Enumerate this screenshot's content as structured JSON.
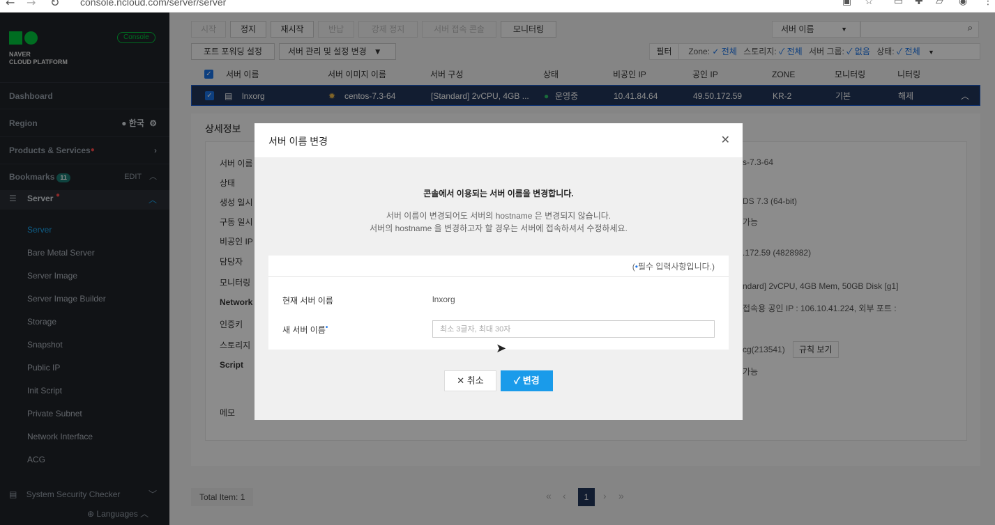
{
  "browser": {
    "url": "console.ncloud.com/server/server",
    "back_icon": "back-arrow-icon",
    "forward_icon": "forward-arrow-icon",
    "reload_icon": "reload-icon"
  },
  "sidebar": {
    "logo_line1": "NAVER",
    "logo_line2": "CLOUD PLATFORM",
    "console_badge": "Console",
    "dashboard": "Dashboard",
    "region_label": "Region",
    "region_value": "한국",
    "products": "Products & Services",
    "bookmarks": "Bookmarks",
    "bookmarks_count": "11",
    "bookmarks_edit": "EDIT",
    "server_group": "Server",
    "items": [
      {
        "label": "Server",
        "active": true
      },
      {
        "label": "Bare Metal Server",
        "active": false
      },
      {
        "label": "Server Image",
        "active": false
      },
      {
        "label": "Server Image Builder",
        "active": false
      },
      {
        "label": "Storage",
        "active": false
      },
      {
        "label": "Snapshot",
        "active": false
      },
      {
        "label": "Public IP",
        "active": false
      },
      {
        "label": "Init Script",
        "active": false
      },
      {
        "label": "Private Subnet",
        "active": false
      },
      {
        "label": "Network Interface",
        "active": false
      },
      {
        "label": "ACG",
        "active": false
      }
    ],
    "security_checker": "System Security Checker",
    "languages": "Languages"
  },
  "toolbar": {
    "start": "시작",
    "stop": "정지",
    "restart": "재시작",
    "return": "반납",
    "force_stop": "강제 정지",
    "console_access": "서버 접속 콘솔",
    "monitoring": "모니터링",
    "port_forward": "포트 포워딩 설정",
    "manage": "서버 관리 및 설정 변경",
    "search_select": "서버 이름",
    "filter": "필터",
    "filter_zone": "Zone:",
    "filter_all": "전체",
    "filter_storage": "스토리지:",
    "filter_group": "서버 그룹:",
    "filter_none": "없음",
    "filter_status": "상태:"
  },
  "table": {
    "headers": [
      "서버 이름",
      "서버 이미지 이름",
      "서버 구성",
      "상태",
      "비공인 IP",
      "공인 IP",
      "ZONE",
      "모니터링",
      "니터링"
    ],
    "row": {
      "name": "lnxorg",
      "image": "centos-7.3-64",
      "spec": "[Standard] 2vCPU, 4GB ...",
      "status": "운영중",
      "private_ip": "10.41.84.64",
      "public_ip": "49.50.172.59",
      "zone": "KR-2",
      "monitoring": "기본",
      "monitoring2": "해제"
    }
  },
  "detail": {
    "title": "상세정보",
    "labels": [
      "서버 이름",
      "상태",
      "생성 일시",
      "구동 일시",
      "비공인 IP",
      "담당자",
      "모니터링",
      "Network",
      "인증키",
      "스토리지",
      "Script",
      "메모"
    ],
    "values": [
      "s-7.3-64",
      "DS 7.3 (64-bit)",
      "가능",
      ".172.59 (4828982)",
      "ndard] 2vCPU, 4GB Mem, 50GB Disk [g1]",
      "접속용 공인 IP : 106.10.41.224, 외부 포트 :",
      "cg(213541)",
      "가능"
    ],
    "rule_button": "규칙 보기"
  },
  "pager": {
    "total_label": "Total Item:",
    "total_value": "1",
    "current_page": "1"
  },
  "modal": {
    "title": "서버 이름 변경",
    "lead": "콘솔에서 이용되는 서버 이름을 변경합니다.",
    "desc1": "서버 이름이 변경되어도 서버의 hostname 은 변경되지 않습니다.",
    "desc2": "서버의 hostname 을 변경하고자 할 경우는 서버에 접속하셔서 수정하세요.",
    "required_note": "필수 입력사항입니다.)",
    "current_label": "현재 서버 이름",
    "current_value": "lnxorg",
    "new_label": "새 서버 이름",
    "new_placeholder": "최소 3글자, 최대 30자",
    "cancel": "취소",
    "confirm": "변경"
  }
}
